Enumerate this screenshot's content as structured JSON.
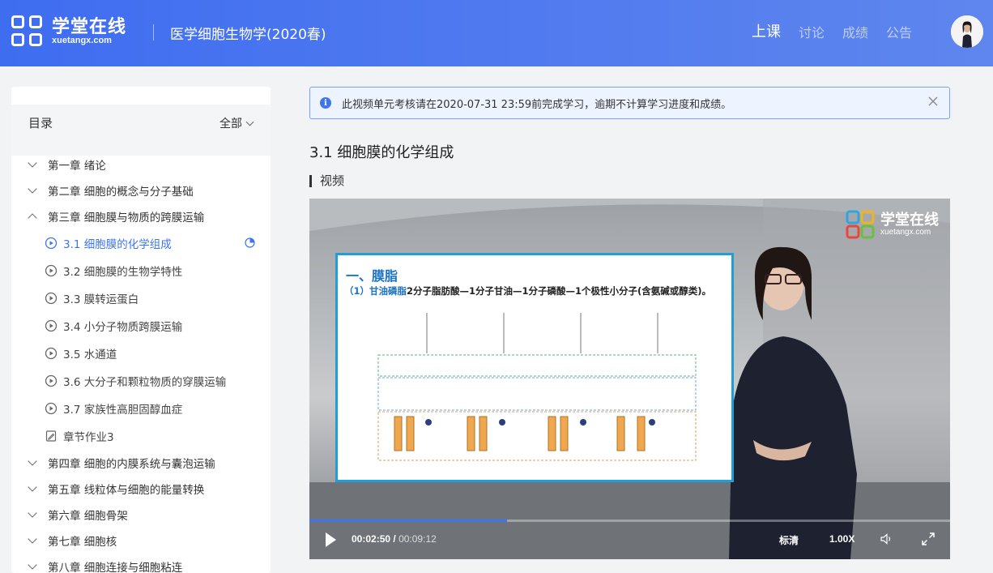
{
  "header": {
    "logo_cn": "学堂在线",
    "logo_en": "xuetangx.com",
    "course_title": "医学细胞生物学(2020春)",
    "nav": [
      "上课",
      "讨论",
      "成绩",
      "公告"
    ],
    "active_nav": "上课"
  },
  "sidebar": {
    "title": "目录",
    "filter_label": "全部",
    "chapters_before": [
      "第一章 绪论",
      "第二章 细胞的概念与分子基础"
    ],
    "open_chapter": "第三章 细胞膜与物质的跨膜运输",
    "lessons": [
      "3.1 细胞膜的化学组成",
      "3.2 细胞膜的生物学特性",
      "3.3 膜转运蛋白",
      "3.4 小分子物质跨膜运输",
      "3.5 水通道",
      "3.6 大分子和颗粒物质的穿膜运输",
      "3.7 家族性高胆固醇血症"
    ],
    "homework": "章节作业3",
    "chapters_after": [
      "第四章 细胞的内膜系统与囊泡运输",
      "第五章 线粒体与细胞的能量转换",
      "第六章 细胞骨架",
      "第七章 细胞核",
      "第八章 细胞连接与细胞粘连"
    ]
  },
  "notice": {
    "text": "此视频单元考核请在2020-07-31 23:59前完成学习，逾期不计算学习进度和成绩。"
  },
  "lesson": {
    "title": "3.1 细胞膜的化学组成",
    "section_label": "视频"
  },
  "player": {
    "watermark_cn": "学堂在线",
    "watermark_en": "xuetangx.com",
    "slide_title": "一、膜脂",
    "slide_sub_label": "（1）甘油磷脂",
    "slide_sub_text": "2分子脂肪酸—1分子甘油—1分子磷酸—1个极性小分子(含氨碱或醇类)。",
    "current_time": "00:02:50",
    "separator": "/",
    "total_time": "00:09:12",
    "progress": 0.308,
    "quality": "标清",
    "speed": "1.00X"
  },
  "colors": {
    "accent": "#3e74f0",
    "header_start": "#3f6df0",
    "header_end": "#5f86ee"
  }
}
